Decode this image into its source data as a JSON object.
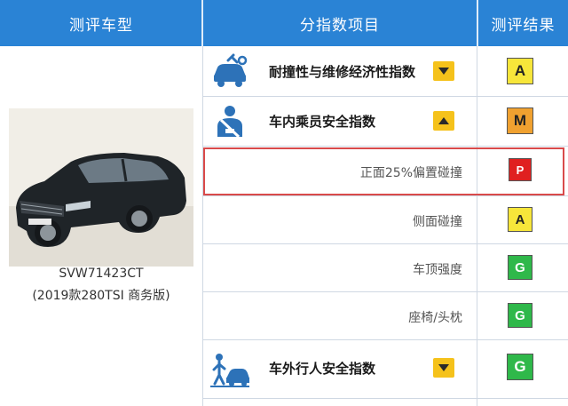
{
  "header": {
    "col1": "测评车型",
    "col2": "分指数项目",
    "col3": "测评结果"
  },
  "car": {
    "model": "SVW71423CT",
    "year_trim": "(2019款280TSI 商务版)"
  },
  "rows": [
    {
      "label": "耐撞性与维修经济性指数",
      "type": "main",
      "icon": "car-repair-icon",
      "toggle": "chevron-down-icon",
      "grade": "A",
      "grade_color": "#f7e63a",
      "grade_text_color": "#222222"
    },
    {
      "label": "车内乘员安全指数",
      "type": "main",
      "icon": "seatbelt-occupant-icon",
      "toggle": "chevron-up-icon",
      "grade": "M",
      "grade_color": "#f0a130",
      "grade_text_color": "#222222"
    },
    {
      "label": "正面25%偏置碰撞",
      "type": "sub",
      "grade": "P",
      "grade_color": "#e02020",
      "grade_text_color": "#ffffff"
    },
    {
      "label": "侧面碰撞",
      "type": "sub",
      "grade": "A",
      "grade_color": "#f7e63a",
      "grade_text_color": "#222222"
    },
    {
      "label": "车顶强度",
      "type": "sub",
      "grade": "G",
      "grade_color": "#2fb84a",
      "grade_text_color": "#ffffff"
    },
    {
      "label": "座椅/头枕",
      "type": "sub",
      "grade": "G",
      "grade_color": "#2fb84a",
      "grade_text_color": "#ffffff"
    },
    {
      "label": "车外行人安全指数",
      "type": "main",
      "icon": "pedestrian-car-icon",
      "toggle": "chevron-down-icon",
      "grade": "G",
      "grade_color": "#2fb84a",
      "grade_text_color": "#ffffff"
    }
  ],
  "colors": {
    "header_bg": "#2a83d5",
    "highlight_border": "#d94a4a",
    "toggle_bg": "#f5c21b"
  }
}
